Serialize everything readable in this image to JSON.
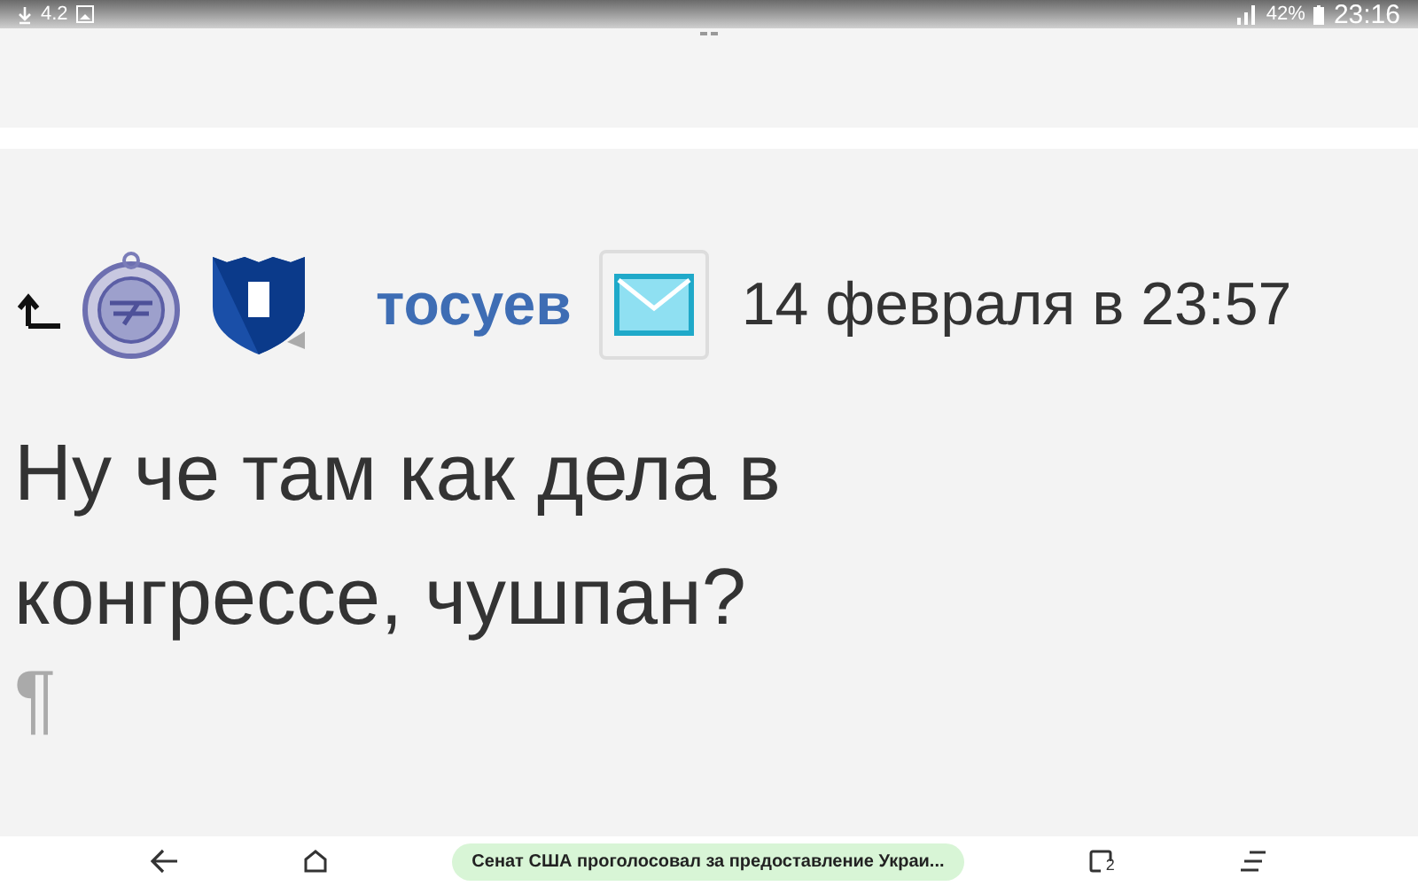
{
  "status_bar": {
    "left_text": "4.2",
    "battery": "42%",
    "time": "23:16"
  },
  "post": {
    "author": "тосуев",
    "date": "14 февраля в 23:57",
    "text": "Ну че там как дела в конгрессе, чушпан?",
    "pilcrow": "¶"
  },
  "nav_bar": {
    "news": "Сенат США проголосовал за предоставление Украи...",
    "tabs_count": "2"
  }
}
